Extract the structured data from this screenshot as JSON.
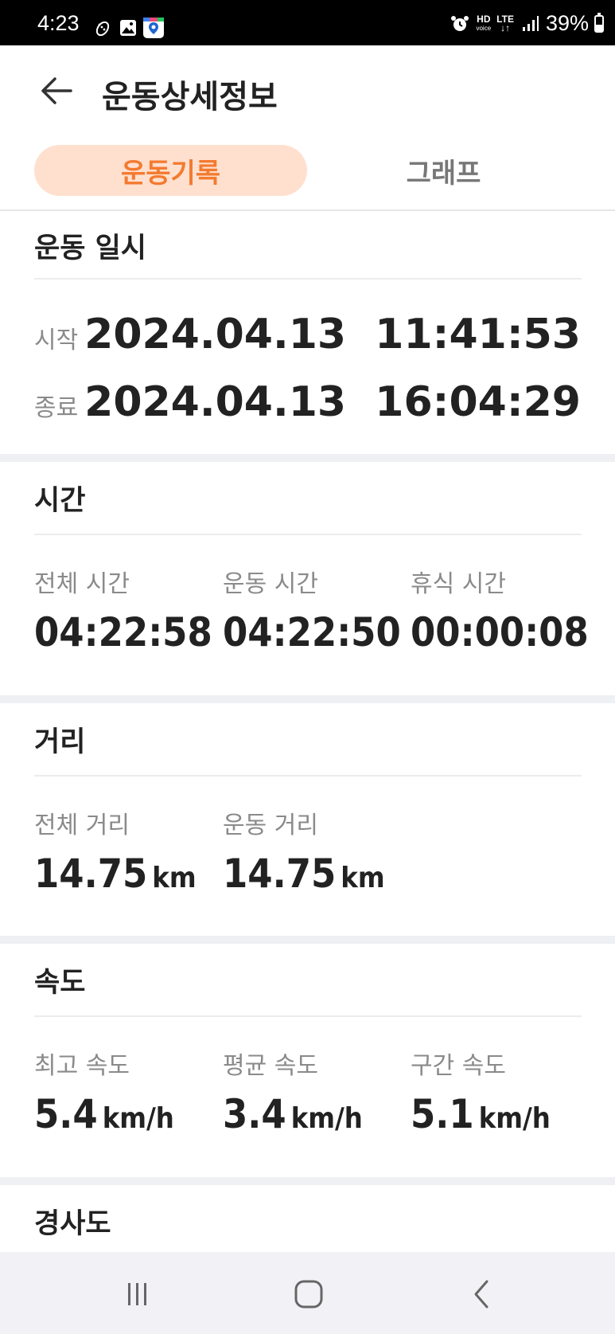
{
  "status_bar": {
    "time": "4:23",
    "battery": "39%",
    "battery_level": 0.39,
    "hd": "HD",
    "voice": "voice",
    "lte": "LTE",
    "left_icons": [
      "walking-app-icon",
      "gallery-icon",
      "maps-icon"
    ],
    "right_icons": [
      "alarm-icon",
      "hd-voice-icon",
      "lte-icon",
      "signal-icon",
      "battery-icon"
    ]
  },
  "header": {
    "title": "운동상세정보",
    "back_icon": "back-arrow-icon"
  },
  "tabs": [
    {
      "label": "운동기록",
      "active": true
    },
    {
      "label": "그래프",
      "active": false
    }
  ],
  "accent_color": "#f47a2f",
  "accent_bg": "#ffe0cf",
  "sections": {
    "datetime": {
      "title": "운동 일시",
      "start_label": "시작",
      "start_value": "2024.04.13  11:41:53",
      "end_label": "종료",
      "end_value": "2024.04.13  16:04:29"
    },
    "time": {
      "title": "시간",
      "items": [
        {
          "label": "전체 시간",
          "value": "04:22:58"
        },
        {
          "label": "운동 시간",
          "value": "04:22:50"
        },
        {
          "label": "휴식 시간",
          "value": "00:00:08"
        }
      ]
    },
    "distance": {
      "title": "거리",
      "items": [
        {
          "label": "전체 거리",
          "value": "14.75",
          "unit": "km"
        },
        {
          "label": "운동 거리",
          "value": "14.75",
          "unit": "km"
        }
      ]
    },
    "speed": {
      "title": "속도",
      "items": [
        {
          "label": "최고 속도",
          "value": "5.4",
          "unit": "km/h"
        },
        {
          "label": "평균 속도",
          "value": "3.4",
          "unit": "km/h"
        },
        {
          "label": "구간 속도",
          "value": "5.1",
          "unit": "km/h"
        }
      ]
    },
    "slope": {
      "title": "경사도"
    }
  },
  "bottom_nav": {
    "buttons": [
      "recent-apps-icon",
      "home-icon",
      "back-icon"
    ]
  }
}
